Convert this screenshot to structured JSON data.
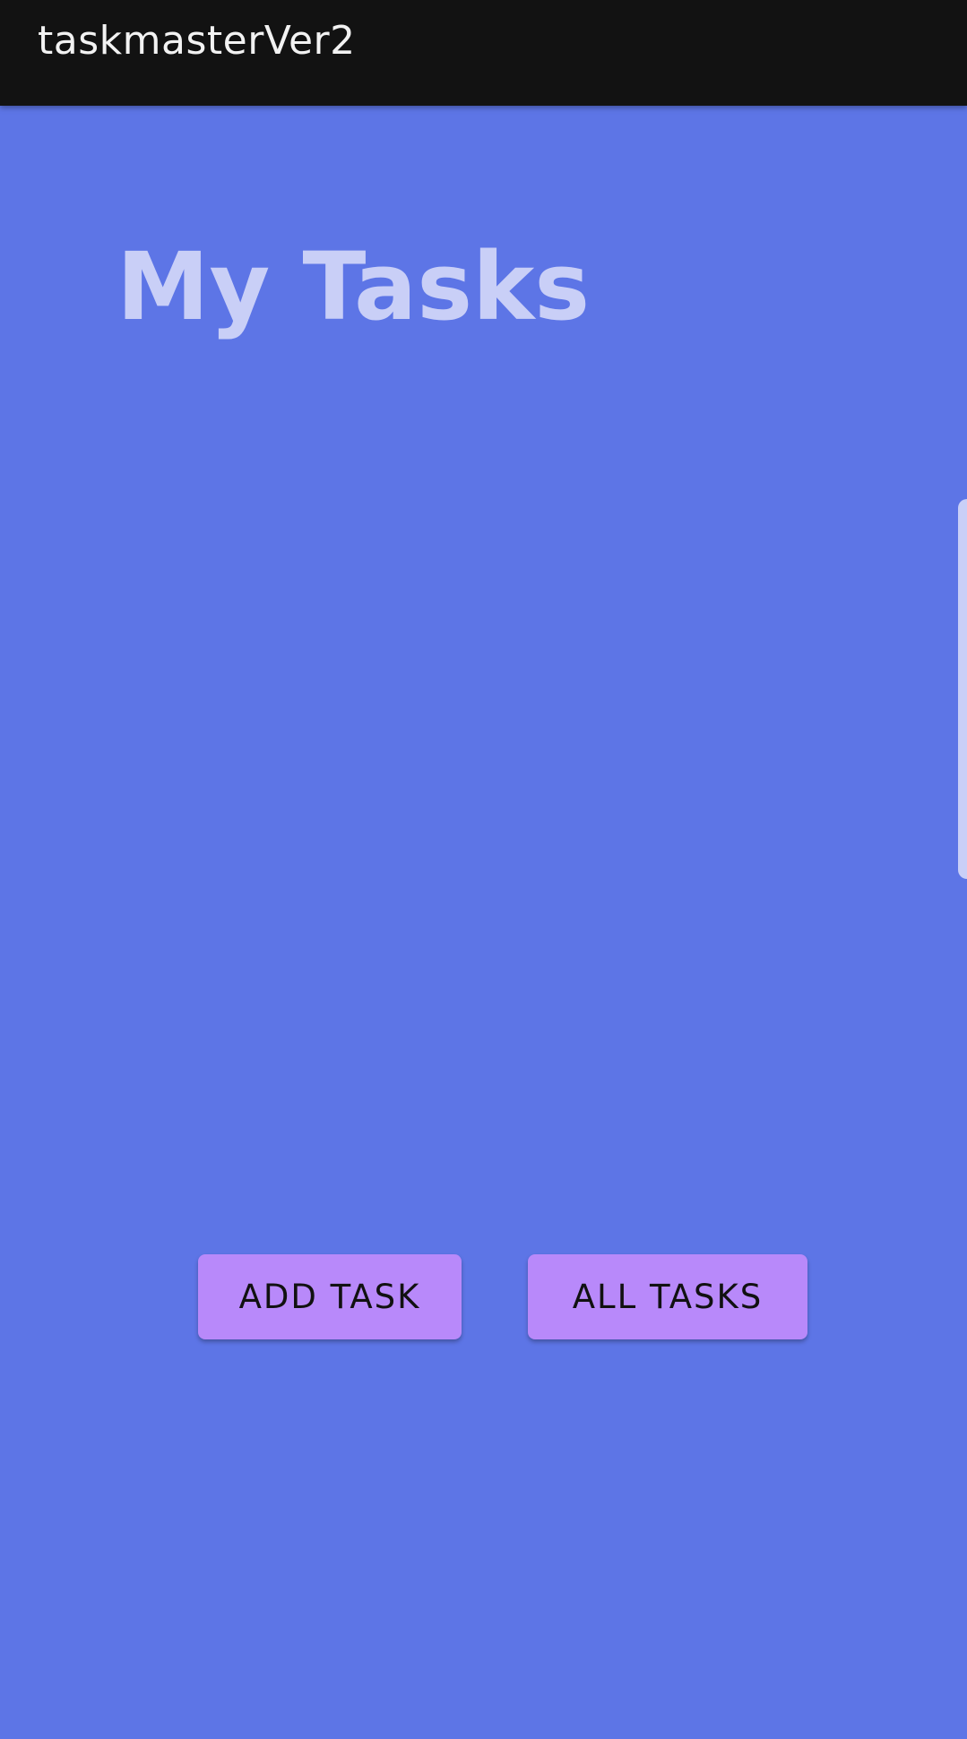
{
  "app_bar": {
    "title": "taskmasterVer2"
  },
  "main": {
    "title": "My Tasks",
    "buttons": {
      "add_task": "ADD TASK",
      "all_tasks": "ALL TASKS"
    }
  },
  "colors": {
    "app_bar_background": "#121212",
    "page_background": "#5d75e6",
    "title_text": "#c9cff7",
    "button_background": "#b889fa",
    "button_text": "#111111"
  }
}
